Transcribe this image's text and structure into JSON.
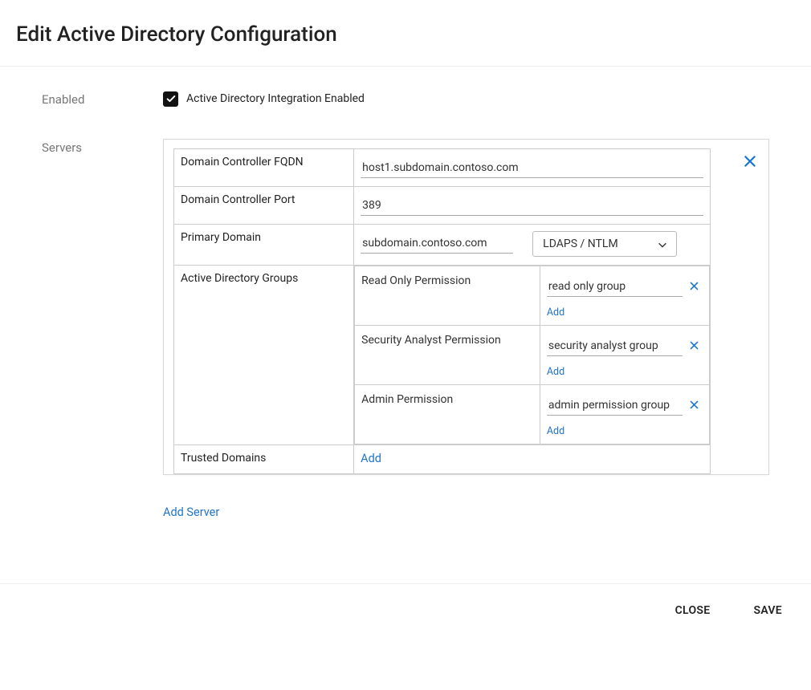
{
  "title": "Edit Active Directory Configuration",
  "labels": {
    "enabled": "Enabled",
    "servers": "Servers",
    "checkbox_label": "Active Directory Integration Enabled",
    "dc_fqdn": "Domain Controller FQDN",
    "dc_port": "Domain Controller Port",
    "primary_domain": "Primary Domain",
    "ad_groups": "Active Directory Groups",
    "trusted_domains": "Trusted Domains",
    "add": "Add",
    "add_server": "Add Server",
    "close": "CLOSE",
    "save": "SAVE"
  },
  "enabled_checked": true,
  "server": {
    "fqdn": "host1.subdomain.contoso.com",
    "port": "389",
    "primary_domain": "subdomain.contoso.com",
    "protocol_selected": "LDAPS / NTLM",
    "groups": {
      "read_only": {
        "label": "Read Only Permission",
        "value": "read only group"
      },
      "security_analyst": {
        "label": "Security Analyst Permission",
        "value": "security analyst group"
      },
      "admin": {
        "label": "Admin Permission",
        "value": "admin permission group"
      }
    }
  }
}
